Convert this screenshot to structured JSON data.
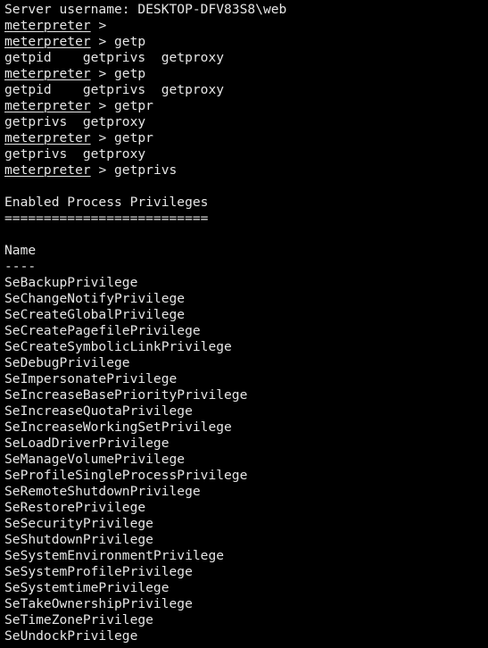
{
  "terminal": {
    "window_kind": "meterpreter-console",
    "background_color": "#000000",
    "foreground_color": "#e6e6e6",
    "prompt_word": "meterpreter",
    "prompt_separator": " > ",
    "session_line": "Server username: DESKTOP-DFV83S8\\web",
    "lines": [
      {
        "type": "output",
        "text": "Server username: DESKTOP-DFV83S8\\web"
      },
      {
        "type": "prompt",
        "command": ""
      },
      {
        "type": "prompt",
        "command": "getp"
      },
      {
        "type": "output",
        "text": "getpid    getprivs  getproxy"
      },
      {
        "type": "prompt",
        "command": "getp"
      },
      {
        "type": "output",
        "text": "getpid    getprivs  getproxy"
      },
      {
        "type": "prompt",
        "command": "getpr"
      },
      {
        "type": "output",
        "text": "getprivs  getproxy"
      },
      {
        "type": "prompt",
        "command": "getpr"
      },
      {
        "type": "output",
        "text": "getprivs  getproxy"
      },
      {
        "type": "prompt",
        "command": "getprivs"
      },
      {
        "type": "blank",
        "text": ""
      },
      {
        "type": "output",
        "text": "Enabled Process Privileges"
      },
      {
        "type": "output",
        "text": "=========================="
      },
      {
        "type": "blank",
        "text": ""
      },
      {
        "type": "output",
        "text": "Name"
      },
      {
        "type": "output",
        "text": "----"
      },
      {
        "type": "output",
        "text": "SeBackupPrivilege"
      },
      {
        "type": "output",
        "text": "SeChangeNotifyPrivilege"
      },
      {
        "type": "output",
        "text": "SeCreateGlobalPrivilege"
      },
      {
        "type": "output",
        "text": "SeCreatePagefilePrivilege"
      },
      {
        "type": "output",
        "text": "SeCreateSymbolicLinkPrivilege"
      },
      {
        "type": "output",
        "text": "SeDebugPrivilege"
      },
      {
        "type": "output",
        "text": "SeImpersonatePrivilege"
      },
      {
        "type": "output",
        "text": "SeIncreaseBasePriorityPrivilege"
      },
      {
        "type": "output",
        "text": "SeIncreaseQuotaPrivilege"
      },
      {
        "type": "output",
        "text": "SeIncreaseWorkingSetPrivilege"
      },
      {
        "type": "output",
        "text": "SeLoadDriverPrivilege"
      },
      {
        "type": "output",
        "text": "SeManageVolumePrivilege"
      },
      {
        "type": "output",
        "text": "SeProfileSingleProcessPrivilege"
      },
      {
        "type": "output",
        "text": "SeRemoteShutdownPrivilege"
      },
      {
        "type": "output",
        "text": "SeRestorePrivilege"
      },
      {
        "type": "output",
        "text": "SeSecurityPrivilege"
      },
      {
        "type": "output",
        "text": "SeShutdownPrivilege"
      },
      {
        "type": "output",
        "text": "SeSystemEnvironmentPrivilege"
      },
      {
        "type": "output",
        "text": "SeSystemProfilePrivilege"
      },
      {
        "type": "output",
        "text": "SeSystemtimePrivilege"
      },
      {
        "type": "output",
        "text": "SeTakeOwnershipPrivilege"
      },
      {
        "type": "output",
        "text": "SeTimeZonePrivilege"
      },
      {
        "type": "output",
        "text": "SeUndockPrivilege"
      }
    ],
    "privileges_table": {
      "title": "Enabled Process Privileges",
      "underline": "==========================",
      "column_header": "Name",
      "column_header_rule": "----",
      "rows": [
        "SeBackupPrivilege",
        "SeChangeNotifyPrivilege",
        "SeCreateGlobalPrivilege",
        "SeCreatePagefilePrivilege",
        "SeCreateSymbolicLinkPrivilege",
        "SeDebugPrivilege",
        "SeImpersonatePrivilege",
        "SeIncreaseBasePriorityPrivilege",
        "SeIncreaseQuotaPrivilege",
        "SeIncreaseWorkingSetPrivilege",
        "SeLoadDriverPrivilege",
        "SeManageVolumePrivilege",
        "SeProfileSingleProcessPrivilege",
        "SeRemoteShutdownPrivilege",
        "SeRestorePrivilege",
        "SeSecurityPrivilege",
        "SeShutdownPrivilege",
        "SeSystemEnvironmentPrivilege",
        "SeSystemProfilePrivilege",
        "SeSystemtimePrivilege",
        "SeTakeOwnershipPrivilege",
        "SeTimeZonePrivilege",
        "SeUndockPrivilege"
      ]
    },
    "tab_completion_suggestions": [
      "getpid",
      "getprivs",
      "getproxy"
    ]
  }
}
